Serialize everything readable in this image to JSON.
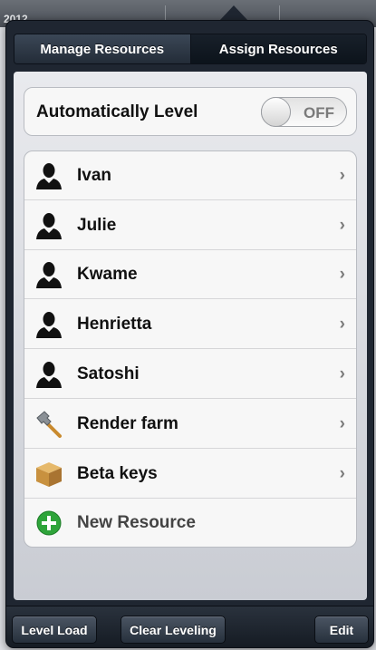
{
  "background": {
    "header_text": "2012"
  },
  "segments": {
    "manage": "Manage Resources",
    "assign": "Assign Resources"
  },
  "auto_level": {
    "label": "Automatically Level",
    "state": "OFF"
  },
  "resources": [
    {
      "name": "Ivan",
      "icon": "person-icon"
    },
    {
      "name": "Julie",
      "icon": "person-icon"
    },
    {
      "name": "Kwame",
      "icon": "person-icon"
    },
    {
      "name": "Henrietta",
      "icon": "person-icon"
    },
    {
      "name": "Satoshi",
      "icon": "person-icon"
    },
    {
      "name": "Render farm",
      "icon": "hammer-icon"
    },
    {
      "name": "Beta keys",
      "icon": "box-icon"
    }
  ],
  "new_resource": {
    "label": "New Resource",
    "icon": "add-circle-icon"
  },
  "toolbar": {
    "level_load": "Level Load",
    "clear_leveling": "Clear Leveling",
    "edit": "Edit"
  },
  "colors": {
    "popover_bg": "#1f2631",
    "add_green": "#2ea43a"
  }
}
